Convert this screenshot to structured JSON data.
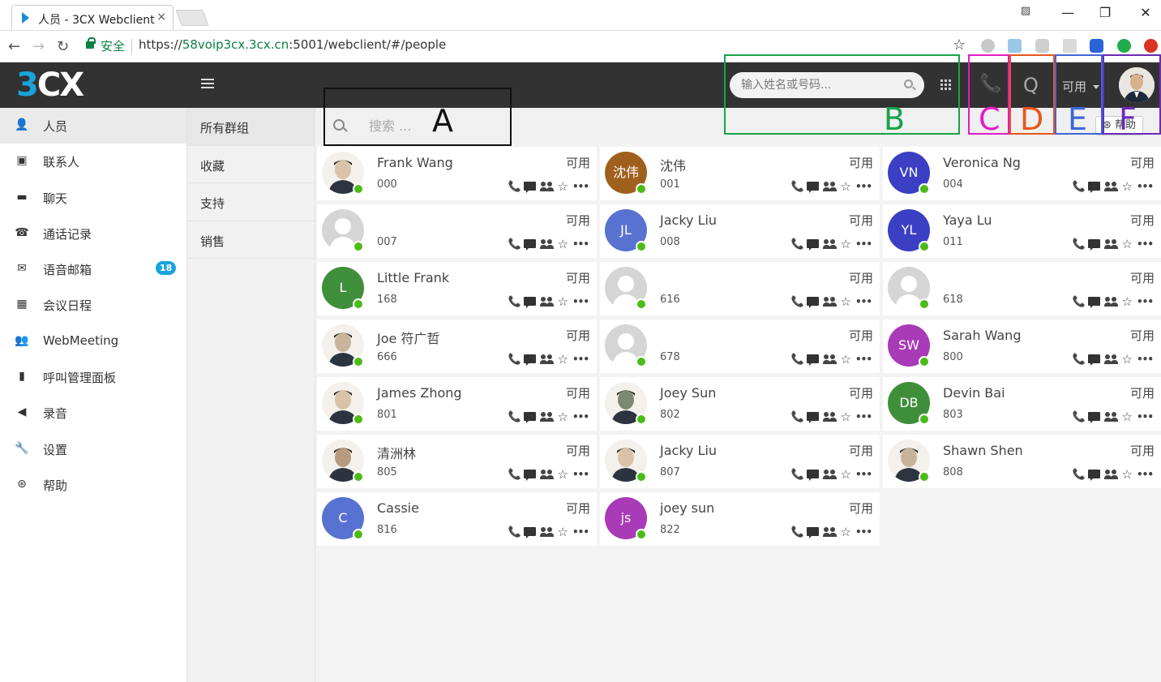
{
  "browser": {
    "tab_title": "人员 - 3CX Webclient",
    "tab_close": "×",
    "secure_label": "安全",
    "url_scheme": "https://",
    "url_host": "58voip3cx.3cx.cn",
    "url_path": ":5001/webclient/#/people",
    "bookmark_star": "☆"
  },
  "header": {
    "logo_three": "3",
    "logo_cx": "CX",
    "search_placeholder": "输入姓名或号码...",
    "queue_letter": "Q",
    "status_label": "可用"
  },
  "sidebar": {
    "items": [
      {
        "label": "人员",
        "icon": "person-icon",
        "glyph": "👤"
      },
      {
        "label": "联系人",
        "icon": "contacts-icon",
        "glyph": "▣"
      },
      {
        "label": "聊天",
        "icon": "chat-icon",
        "glyph": "▬"
      },
      {
        "label": "通话记录",
        "icon": "call-history-icon",
        "glyph": "☎"
      },
      {
        "label": "语音邮箱",
        "icon": "voicemail-icon",
        "glyph": "✉",
        "badge": "18"
      },
      {
        "label": "会议日程",
        "icon": "calendar-icon",
        "glyph": "▦"
      },
      {
        "label": "WebMeeting",
        "icon": "webmeeting-icon",
        "glyph": "👥"
      },
      {
        "label": "呼叫管理面板",
        "icon": "bar-chart-icon",
        "glyph": "▮"
      },
      {
        "label": "录音",
        "icon": "speaker-icon",
        "glyph": "◀"
      },
      {
        "label": "设置",
        "icon": "wrench-icon",
        "glyph": "🔧"
      },
      {
        "label": "帮助",
        "icon": "lifebuoy-icon",
        "glyph": "⊛"
      }
    ]
  },
  "groups": [
    "所有群组",
    "收藏",
    "支持",
    "销售"
  ],
  "toolbar": {
    "search_placeholder": "搜索 ...",
    "help_label": "帮助"
  },
  "presence_color": "#4cbb17",
  "contacts": [
    {
      "name": "Frank Wang",
      "ext": "000",
      "status": "可用",
      "initials": "",
      "color": "#d9c3a8",
      "photo": true
    },
    {
      "name": "沈伟",
      "ext": "001",
      "status": "可用",
      "initials": "沈伟",
      "color": "#a0601d",
      "photo": false
    },
    {
      "name": "Veronica Ng",
      "ext": "004",
      "status": "可用",
      "initials": "VN",
      "color": "#3b3fc4",
      "photo": false
    },
    {
      "name": "",
      "ext": "007",
      "status": "可用",
      "initials": "",
      "color": "#d5d5d5",
      "photo": false,
      "placeholder": true
    },
    {
      "name": "Jacky Liu",
      "ext": "008",
      "status": "可用",
      "initials": "JL",
      "color": "#5872d1",
      "photo": false
    },
    {
      "name": "Yaya Lu",
      "ext": "011",
      "status": "可用",
      "initials": "YL",
      "color": "#3b3fc4",
      "photo": false
    },
    {
      "name": "Little Frank",
      "ext": "168",
      "status": "可用",
      "initials": "L",
      "color": "#3f8f3a",
      "photo": false
    },
    {
      "name": "",
      "ext": "616",
      "status": "可用",
      "initials": "",
      "color": "#d5d5d5",
      "photo": false,
      "placeholder": true
    },
    {
      "name": "",
      "ext": "618",
      "status": "可用",
      "initials": "",
      "color": "#d5d5d5",
      "photo": false,
      "placeholder": true
    },
    {
      "name": "Joe 符广哲",
      "ext": "666",
      "status": "可用",
      "initials": "",
      "color": "#c9b59c",
      "photo": true
    },
    {
      "name": "",
      "ext": "678",
      "status": "可用",
      "initials": "",
      "color": "#d5d5d5",
      "photo": false,
      "placeholder": true
    },
    {
      "name": "Sarah Wang",
      "ext": "800",
      "status": "可用",
      "initials": "SW",
      "color": "#a93ab8",
      "photo": false
    },
    {
      "name": "James Zhong",
      "ext": "801",
      "status": "可用",
      "initials": "",
      "color": "#d9c3a8",
      "photo": true
    },
    {
      "name": "Joey Sun",
      "ext": "802",
      "status": "可用",
      "initials": "",
      "color": "#7a8a70",
      "photo": true
    },
    {
      "name": "Devin Bai",
      "ext": "803",
      "status": "可用",
      "initials": "DB",
      "color": "#3f8f3a",
      "photo": false
    },
    {
      "name": "清洲林",
      "ext": "805",
      "status": "可用",
      "initials": "",
      "color": "#b89a80",
      "photo": true
    },
    {
      "name": "Jacky Liu",
      "ext": "807",
      "status": "可用",
      "initials": "",
      "color": "#d9c3a8",
      "photo": true
    },
    {
      "name": "Shawn Shen",
      "ext": "808",
      "status": "可用",
      "initials": "",
      "color": "#c7b39b",
      "photo": true
    },
    {
      "name": "Cassie",
      "ext": "816",
      "status": "可用",
      "initials": "C",
      "color": "#5872d1",
      "photo": false
    },
    {
      "name": "joey sun",
      "ext": "822",
      "status": "可用",
      "initials": "js",
      "color": "#a93ab8",
      "photo": false
    }
  ],
  "annotations": [
    {
      "label": "A",
      "color": "#111111"
    },
    {
      "label": "B",
      "color": "#17a34a"
    },
    {
      "label": "C",
      "color": "#e21cc8"
    },
    {
      "label": "D",
      "color": "#e8561f"
    },
    {
      "label": "E",
      "color": "#3f66d8"
    },
    {
      "label": "F",
      "color": "#6a2bb8"
    }
  ]
}
